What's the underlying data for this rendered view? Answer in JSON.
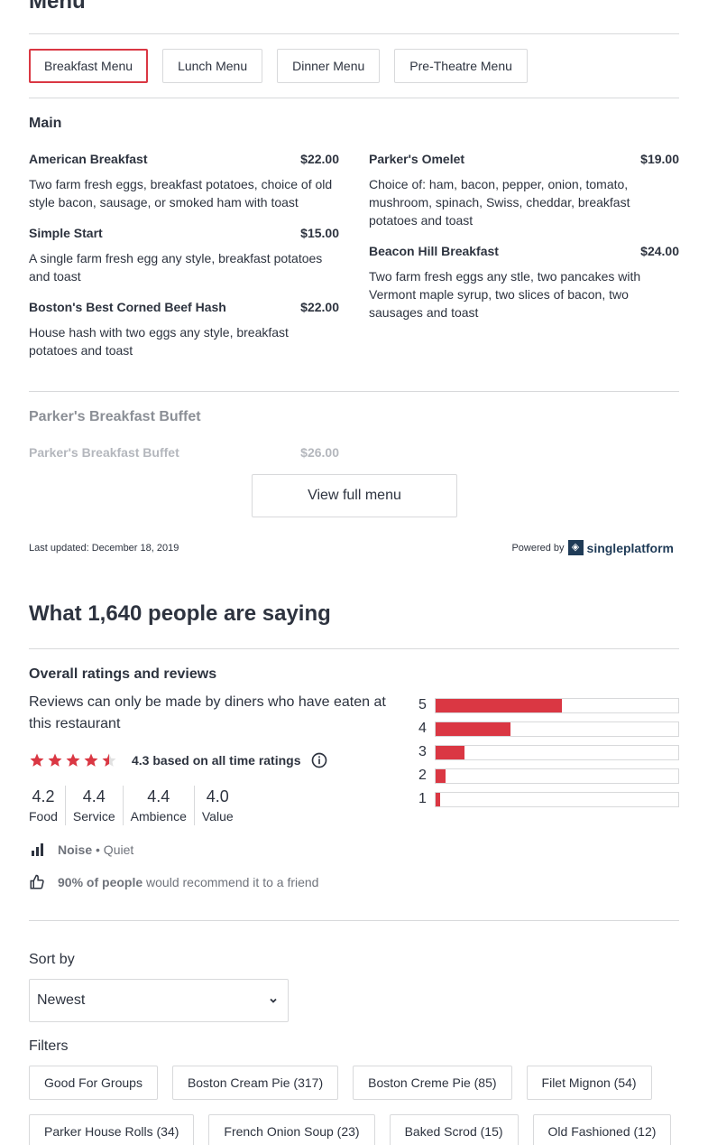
{
  "menu": {
    "title": "Menu",
    "tabs": [
      "Breakfast Menu",
      "Lunch Menu",
      "Dinner Menu",
      "Pre-Theatre Menu"
    ],
    "section": "Main",
    "left_items": [
      {
        "name": "American Breakfast",
        "price": "$22.00",
        "desc": "Two farm fresh eggs, breakfast potatoes, choice of old style bacon, sausage, or smoked ham with toast"
      },
      {
        "name": "Simple Start",
        "price": "$15.00",
        "desc": "A single farm fresh egg any style, breakfast potatoes and toast"
      },
      {
        "name": "Boston's Best Corned Beef Hash",
        "price": "$22.00",
        "desc": "House hash with two eggs any style, breakfast potatoes and toast"
      }
    ],
    "right_items": [
      {
        "name": "Parker's Omelet",
        "price": "$19.00",
        "desc": "Choice of: ham, bacon, pepper, onion, tomato, mushroom, spinach, Swiss, cheddar, breakfast potatoes and toast"
      },
      {
        "name": "Beacon Hill Breakfast",
        "price": "$24.00",
        "desc": "Two farm fresh eggs any stle, two pancakes with Vermont maple syrup, two slices of bacon, two sausages and toast"
      }
    ],
    "buffet_section": "Parker's Breakfast Buffet",
    "buffet_item": {
      "name": "Parker's Breakfast Buffet",
      "price": "$26.00"
    },
    "view_full": "View full menu",
    "last_updated": "Last updated: December 18, 2019",
    "powered_by": "Powered by",
    "powered_brand": "singleplatform"
  },
  "reviews": {
    "title": "What 1,640 people are saying",
    "overall_title": "Overall ratings and reviews",
    "note": "Reviews can only be made by diners who have eaten at this restaurant",
    "rating_text": "4.3 based on all time ratings",
    "stars_value": 4.3,
    "subratings": [
      {
        "value": "4.2",
        "label": "Food"
      },
      {
        "value": "4.4",
        "label": "Service"
      },
      {
        "value": "4.4",
        "label": "Ambience"
      },
      {
        "value": "4.0",
        "label": "Value"
      }
    ],
    "noise_label": "Noise",
    "noise_value": "• Quiet",
    "recommend_bold": "90% of people",
    "recommend_rest": "would recommend it to a friend",
    "distribution": [
      {
        "star": "5",
        "fraction": 0.52
      },
      {
        "star": "4",
        "fraction": 0.31
      },
      {
        "star": "3",
        "fraction": 0.12
      },
      {
        "star": "2",
        "fraction": 0.04
      },
      {
        "star": "1",
        "fraction": 0.02
      }
    ],
    "accent_color": "#da3743"
  },
  "sort": {
    "label": "Sort by",
    "value": "Newest"
  },
  "filters": {
    "label": "Filters",
    "items": [
      "Good For Groups",
      "Boston Cream Pie (317)",
      "Boston Creme Pie (85)",
      "Filet Mignon (54)",
      "Parker House Rolls (34)",
      "French Onion Soup (23)",
      "Baked Scrod (15)",
      "Old Fashioned (12)"
    ]
  }
}
